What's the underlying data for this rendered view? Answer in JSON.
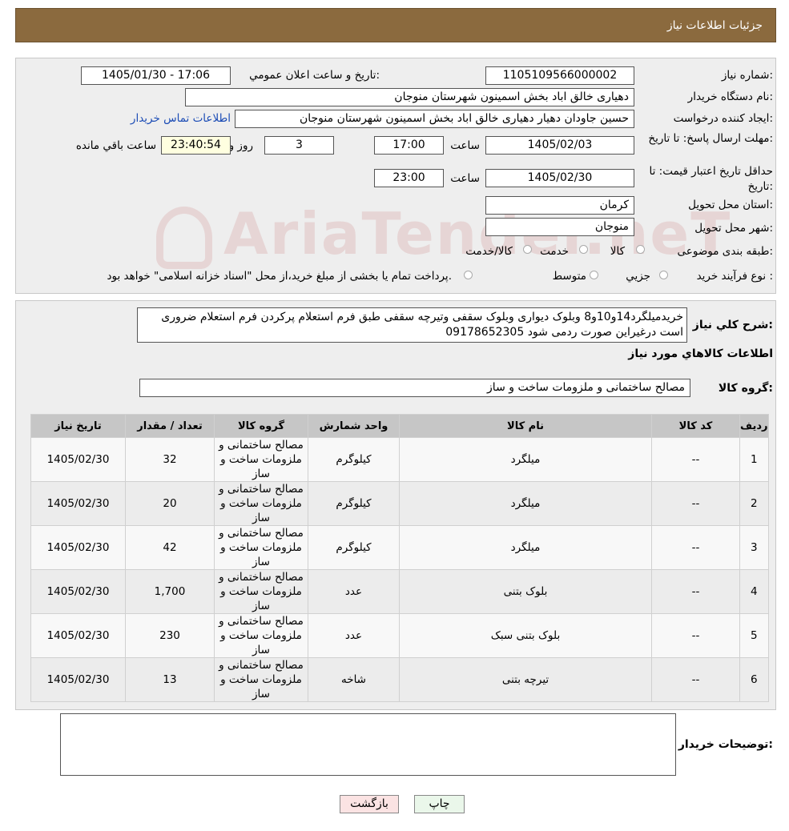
{
  "header": {
    "title": "جزئیات اطلاعات نیاز"
  },
  "form": {
    "need_number_label": "شماره نیاز:",
    "need_number": "1105109566000002",
    "announce_label": "تاریخ و ساعت اعلان عمومي:",
    "announce_value": "1405/01/30 - 17:06",
    "buyer_org_label": "نام دستگاه خريدار:",
    "buyer_org": "دهیاری خالق اباد بخش اسمینون شهرستان منوجان",
    "requester_label": "ايجاد كننده درخواست:",
    "requester": "حسین جاودان دهیار  دهیاری خالق اباد بخش اسمینون شهرستان منوجان",
    "contact_link": "اطلاعات تماس خريدار",
    "deadline_label": "مهلت ارسال پاسخ: تا تاریخ:",
    "deadline_date": "1405/02/03",
    "time_label": "ساعت",
    "deadline_time": "17:00",
    "days_value": "3",
    "days_label": "روز و",
    "remaining_time": "23:40:54",
    "remaining_label": "ساعت باقي مانده",
    "validity_label": "حداقل تاريخ اعتبار قيمت: تا تاریخ:",
    "validity_date": "1405/02/30",
    "validity_time": "23:00",
    "province_label": "استان محل تحويل:",
    "province": "كرمان",
    "city_label": "شهر محل تحويل:",
    "city": "منوجان",
    "category_label": "طبقه بندی موضوعی:",
    "category_options": [
      "كالا",
      "خدمت",
      "كالا/خدمت"
    ],
    "process_label": "نوع فرآيند خريد :",
    "process_options": [
      "جزيي",
      "متوسط"
    ],
    "process_note": "پرداخت تمام يا بخشی از مبلغ خريد،از محل \"اسناد خزانه اسلامی\" خواهد بود."
  },
  "watermark": {
    "text": "AriaTender.neT"
  },
  "description": {
    "label": "شرح كلي نياز:",
    "text": "خریدمیلگرد14و10و8 وبلوک دیواری وبلوک سقفی وتیرچه سقفی طبق فرم استعلام پرکردن فرم استعلام ضروری است درغیراین صورت ردمی شود 09178652305"
  },
  "goods": {
    "section_title": "اطلاعات كالاهاي مورد نياز",
    "group_label": "گروه كالا:",
    "group_value": "مصالح ساختمانی و ملزومات ساخت و ساز",
    "columns": [
      "رديف",
      "كد كالا",
      "نام كالا",
      "واحد شمارش",
      "گروه كالا",
      "تعداد / مقدار",
      "تاريخ نياز"
    ],
    "rows": [
      {
        "idx": "1",
        "code": "--",
        "name": "میلگرد",
        "unit": "کیلوگرم",
        "group": "مصالح ساختمانی و ملزومات ساخت و ساز",
        "qty": "32",
        "date": "1405/02/30"
      },
      {
        "idx": "2",
        "code": "--",
        "name": "میلگرد",
        "unit": "کیلوگرم",
        "group": "مصالح ساختمانی و ملزومات ساخت و ساز",
        "qty": "20",
        "date": "1405/02/30"
      },
      {
        "idx": "3",
        "code": "--",
        "name": "میلگرد",
        "unit": "کیلوگرم",
        "group": "مصالح ساختمانی و ملزومات ساخت و ساز",
        "qty": "42",
        "date": "1405/02/30"
      },
      {
        "idx": "4",
        "code": "--",
        "name": "بلوک بتنی",
        "unit": "عدد",
        "group": "مصالح ساختمانی و ملزومات ساخت و ساز",
        "qty": "1,700",
        "date": "1405/02/30"
      },
      {
        "idx": "5",
        "code": "--",
        "name": "بلوک بتنی سبک",
        "unit": "عدد",
        "group": "مصالح ساختمانی و ملزومات ساخت و ساز",
        "qty": "230",
        "date": "1405/02/30"
      },
      {
        "idx": "6",
        "code": "--",
        "name": "تیرچه بتنی",
        "unit": "شاخه",
        "group": "مصالح ساختمانی و ملزومات ساخت و ساز",
        "qty": "13",
        "date": "1405/02/30"
      }
    ]
  },
  "buyer_notes": {
    "label": "توضيحات خريدار:",
    "text": ""
  },
  "buttons": {
    "print": "چاپ",
    "back": "بازگشت"
  }
}
